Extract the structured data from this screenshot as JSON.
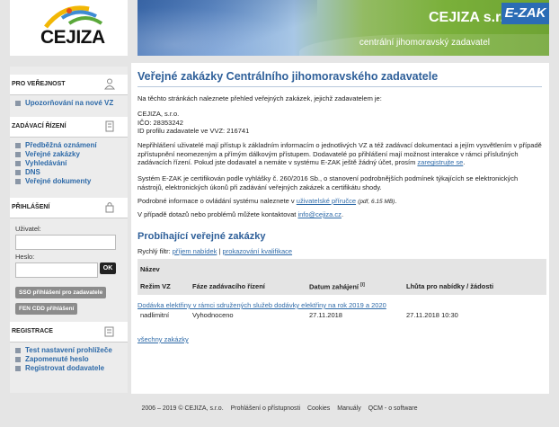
{
  "logo": {
    "text": "CEJIZA"
  },
  "banner": {
    "title": "CEJIZA s.r.o.",
    "subtitle": "centrální jihomoravský zadavatel",
    "ezak": "E-ZAK"
  },
  "sidebar": {
    "public": {
      "heading": "PRO VEŘEJNOST",
      "items": [
        "Upozorňování na nové VZ"
      ]
    },
    "contracting": {
      "heading": "ZADÁVACÍ ŘÍZENÍ",
      "items": [
        "Předběžná oznámení",
        "Veřejné zakázky",
        "Vyhledávání",
        "DNS",
        "Veřejné dokumenty"
      ]
    },
    "login": {
      "heading": "PŘIHLÁŠENÍ",
      "user_label": "Uživatel:",
      "password_label": "Heslo:",
      "ok_label": "OK",
      "sso_label": "SSO přihlášení pro zadavatele",
      "fen_label": "FEN CDD přihlášení"
    },
    "registration": {
      "heading": "REGISTRACE",
      "items": [
        "Test nastavení prohlížeče",
        "Zapomenuté heslo",
        "Registrovat dodavatele"
      ]
    }
  },
  "main": {
    "title": "Veřejné zakázky Centrálního jihomoravského zadavatele",
    "intro": "Na těchto stránkách naleznete přehled veřejných zakázek, jejichž zadavatelem je:",
    "org_name": "CEJIZA, s.r.o.",
    "org_ico": "IČO: 28353242",
    "org_id": "ID profilu zadavatele ve VVZ: 216741",
    "access_text": "Nepřihlášení uživatelé mají přístup k základním informacím o jednotlivých VZ a též zadávací dokumentaci a jejím vysvětlením v případě zpřístupnění neomezeným a přímým dálkovým přístupem. Dodavatelé po přihlášení mají možnost interakce v rámci příslušných zadávacích řízení. Pokud jste dodavatel a nemáte v systému E-ZAK ještě žádný účet, prosím",
    "access_link": "zaregistrujte se",
    "cert_text": "Systém E-ZAK je certifikován podle vyhlášky č. 260/2016 Sb., o stanovení podrobnějších podmínek týkajících se elektronických nástrojů, elektronických úkonů při zadávání veřejných zakázek a certifikátu shody.",
    "manual_text": "Podrobné informace o ovládání systému naleznete v",
    "manual_link": "uživatelské příručce",
    "manual_size": "(pdf, 6.15 MB)",
    "contact_text": "V případě dotazů nebo problémů můžete kontaktovat",
    "contact_link": "info@cejiza.cz",
    "ongoing_title": "Probíhající veřejné zakázky",
    "quick_filter_label": "Rychlý filtr:",
    "quick_filter_1": "příjem nabídek",
    "quick_filter_sep": "|",
    "quick_filter_2": "prokazování kvalifikace",
    "table": {
      "col_name": "Název",
      "col_mode": "Režim VZ",
      "col_phase": "Fáze zadávacího řízení",
      "col_start": "Datum zahájení",
      "col_start_note": "[i]",
      "col_deadline": "Lhůta pro nabídky / žádosti",
      "row_title": "Dodávka elektřiny v rámci sdružených služeb dodávky elektřiny na rok 2019 a 2020",
      "row_mode": "nadlimitní",
      "row_phase": "Vyhodnoceno",
      "row_start": "27.11.2018",
      "row_deadline": "27.11.2018 10:30"
    },
    "all_link": "všechny zakázky"
  },
  "footer": {
    "copyright": "2006 – 2019 © CEJIZA, s.r.o.",
    "accessibility": "Prohlášení o přístupnosti",
    "cookies": "Cookies",
    "manuals": "Manuály",
    "qcm": "QCM - o software"
  }
}
